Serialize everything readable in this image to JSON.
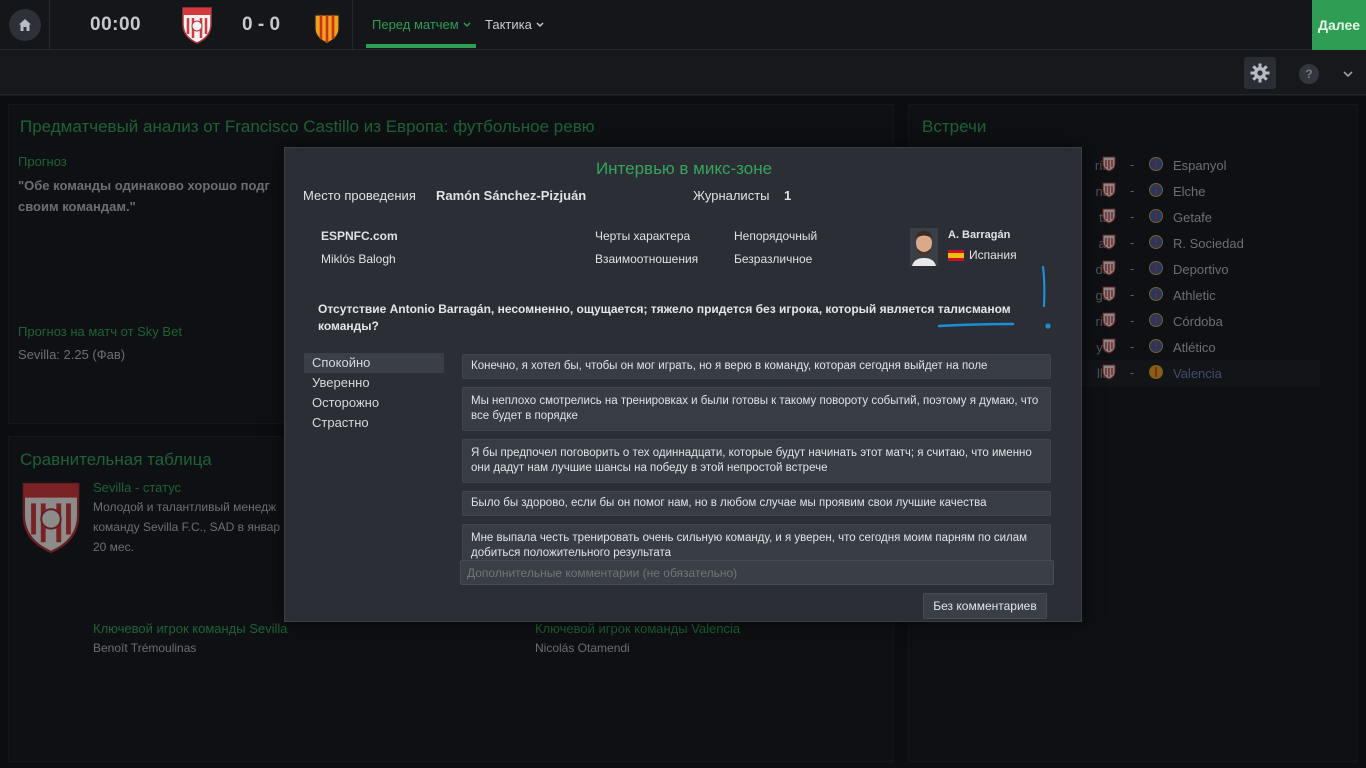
{
  "topbar": {
    "clock": "00:00",
    "score": "0 - 0",
    "tabs": [
      {
        "label": "Перед матчем",
        "active": true
      },
      {
        "label": "Тактика",
        "active": false
      }
    ],
    "next_label": "Далее",
    "accent_color": "#2e9e55"
  },
  "icons": {
    "home": "home-icon",
    "settings": "gear-icon",
    "help": "question-icon",
    "menu": "chevron-down-icon",
    "help_glyph": "?"
  },
  "background": {
    "analysis": {
      "title": "Предматчевый анализ от Francisco Castillo из Европа: футбольное ревю",
      "forecast_label": "Прогноз",
      "forecast_text_line1": "\"Обе команды одинаково хорошо подг",
      "forecast_text_line2": "своим командам.\"",
      "betting_label": "Прогноз на матч от Sky Bet",
      "betting_text": "Sevilla: 2.25 (Фав)"
    },
    "comparison": {
      "title": "Сравнительная таблица",
      "status_label": "Sevilla - статус",
      "status_line1": "Молодой и талантливый менедж",
      "status_line2": "команду Sevilla F.C., SAD в январ",
      "status_line3": "20 мес.",
      "key_player_home_label": "Ключевой игрок команды Sevilla",
      "key_player_home": "Benoît Trémoulinas",
      "key_player_away_label": "Ключевой игрок команды Valencia",
      "key_player_away": "Nicolás Otamendi"
    },
    "fixtures": {
      "title": "Встречи",
      "rows": [
        {
          "home": "ría",
          "away": "Espanyol",
          "highlight": false
        },
        {
          "home": "na",
          "away": "Elche",
          "highlight": false
        },
        {
          "home": "ta",
          "away": "Getafe",
          "highlight": false
        },
        {
          "home": "ar",
          "away": "R. Sociedad",
          "highlight": false
        },
        {
          "home": "da",
          "away": "Deportivo",
          "highlight": false
        },
        {
          "home": "ga",
          "away": "Athletic",
          "highlight": false
        },
        {
          "home": "rid",
          "away": "Córdoba",
          "highlight": false
        },
        {
          "home": "yo",
          "away": "Atlético",
          "highlight": false
        },
        {
          "home": "lla",
          "away": "Valencia",
          "highlight": true
        }
      ],
      "separator": "-"
    }
  },
  "modal": {
    "title": "Интервью в микс-зоне",
    "venue_label": "Место проведения",
    "venue": "Ramón Sánchez-Pizjuán",
    "journalists_label": "Журналисты",
    "journalists_count": "1",
    "outlet": "ESPNFC.com",
    "journalist_name": "Miklós Balogh",
    "trait_label": "Черты характера",
    "trait_value": "Непорядочный",
    "relation_label": "Взаимоотношения",
    "relation_value": "Безразличное",
    "player_name": "A. Barragán",
    "player_nation": "Испания",
    "question": "Отсутствие Antonio Barragán, несомненно, ощущается; тяжело придется без игрока, который является талисманом команды?",
    "tones": [
      {
        "label": "Спокойно",
        "selected": true
      },
      {
        "label": "Уверенно",
        "selected": false
      },
      {
        "label": "Осторожно",
        "selected": false
      },
      {
        "label": "Страстно",
        "selected": false
      }
    ],
    "answers": [
      "Конечно, я хотел бы, чтобы он мог играть, но я верю в команду, которая сегодня выйдет на поле",
      "Мы неплохо смотрелись на тренировках и были готовы к такому повороту событий, поэтому я думаю, что все будет в порядке",
      "Я бы предпочел поговорить о тех одиннадцати, которые будут начинать этот матч; я считаю, что именно они дадут нам лучшие шансы на победу в этой непростой встрече",
      "Было бы здорово, если бы он помог нам, но в любом случае мы проявим свои лучшие качества",
      "Мне выпала честь тренировать очень сильную команду, и я уверен, что сегодня моим парням по силам добиться положительного результата"
    ],
    "comment_placeholder": "Дополнительные комментарии (не обязательно)",
    "no_comment_label": "Без комментариев"
  },
  "colors": {
    "title_green": "#34a55e",
    "annotation_blue": "#1a8fd6",
    "link_blue": "#6f86b8"
  }
}
